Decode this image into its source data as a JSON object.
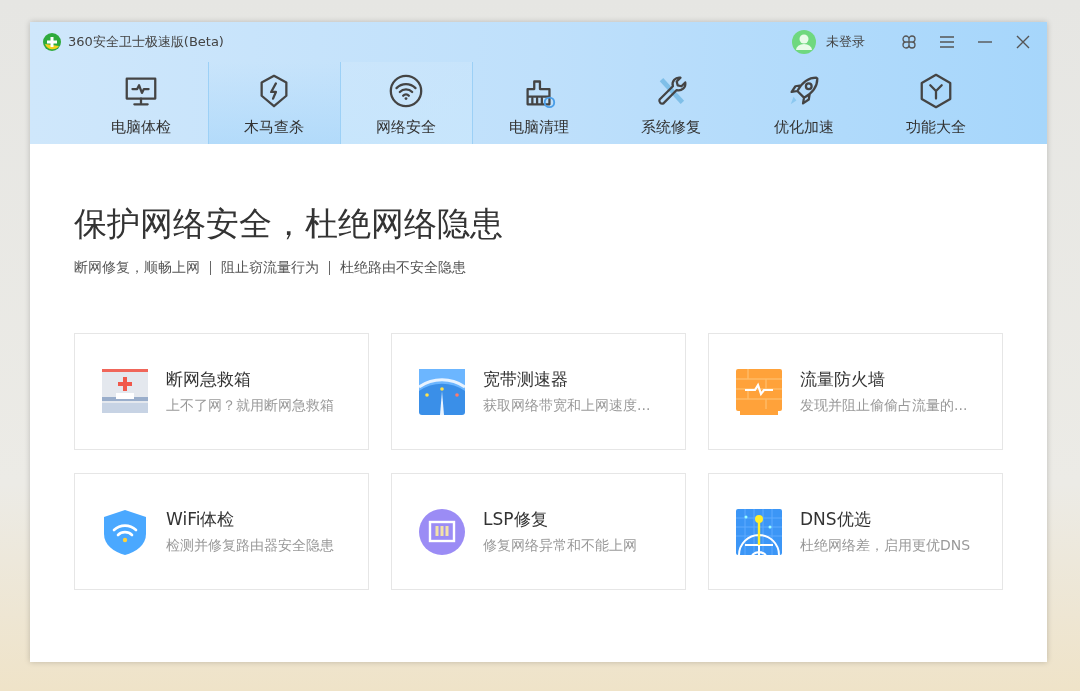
{
  "window": {
    "title": "360安全卫士极速版(Beta)"
  },
  "account": {
    "label": "未登录"
  },
  "tabs": [
    {
      "label": "电脑体检",
      "kind": "monitor",
      "selected": false,
      "hovered": false
    },
    {
      "label": "木马查杀",
      "kind": "shield",
      "selected": false,
      "hovered": true
    },
    {
      "label": "网络安全",
      "kind": "wifi",
      "selected": true,
      "hovered": false
    },
    {
      "label": "电脑清理",
      "kind": "broom",
      "selected": false,
      "hovered": false
    },
    {
      "label": "系统修复",
      "kind": "wrench",
      "selected": false,
      "hovered": false
    },
    {
      "label": "优化加速",
      "kind": "rocket",
      "selected": false,
      "hovered": false
    },
    {
      "label": "功能大全",
      "kind": "hexagon",
      "selected": false,
      "hovered": false
    }
  ],
  "headline": "保护网络安全，杜绝网络隐患",
  "subtitle_parts": [
    "断网修复，顺畅上网",
    "阻止窃流量行为",
    "杜绝路由不安全隐患"
  ],
  "tools": [
    {
      "kind": "firstaid",
      "title": "断网急救箱",
      "description": "上不了网？就用断网急救箱"
    },
    {
      "kind": "speed",
      "title": "宽带测速器",
      "description": "获取网络带宽和上网速度..."
    },
    {
      "kind": "firewall",
      "title": "流量防火墙",
      "description": "发现并阻止偷偷占流量的..."
    },
    {
      "kind": "wifishield",
      "title": "WiFi体检",
      "description": "检测并修复路由器安全隐患"
    },
    {
      "kind": "lsp",
      "title": "LSP修复",
      "description": "修复网络异常和不能上网"
    },
    {
      "kind": "dns",
      "title": "DNS优选",
      "description": "杜绝网络差，启用更优DNS"
    }
  ]
}
